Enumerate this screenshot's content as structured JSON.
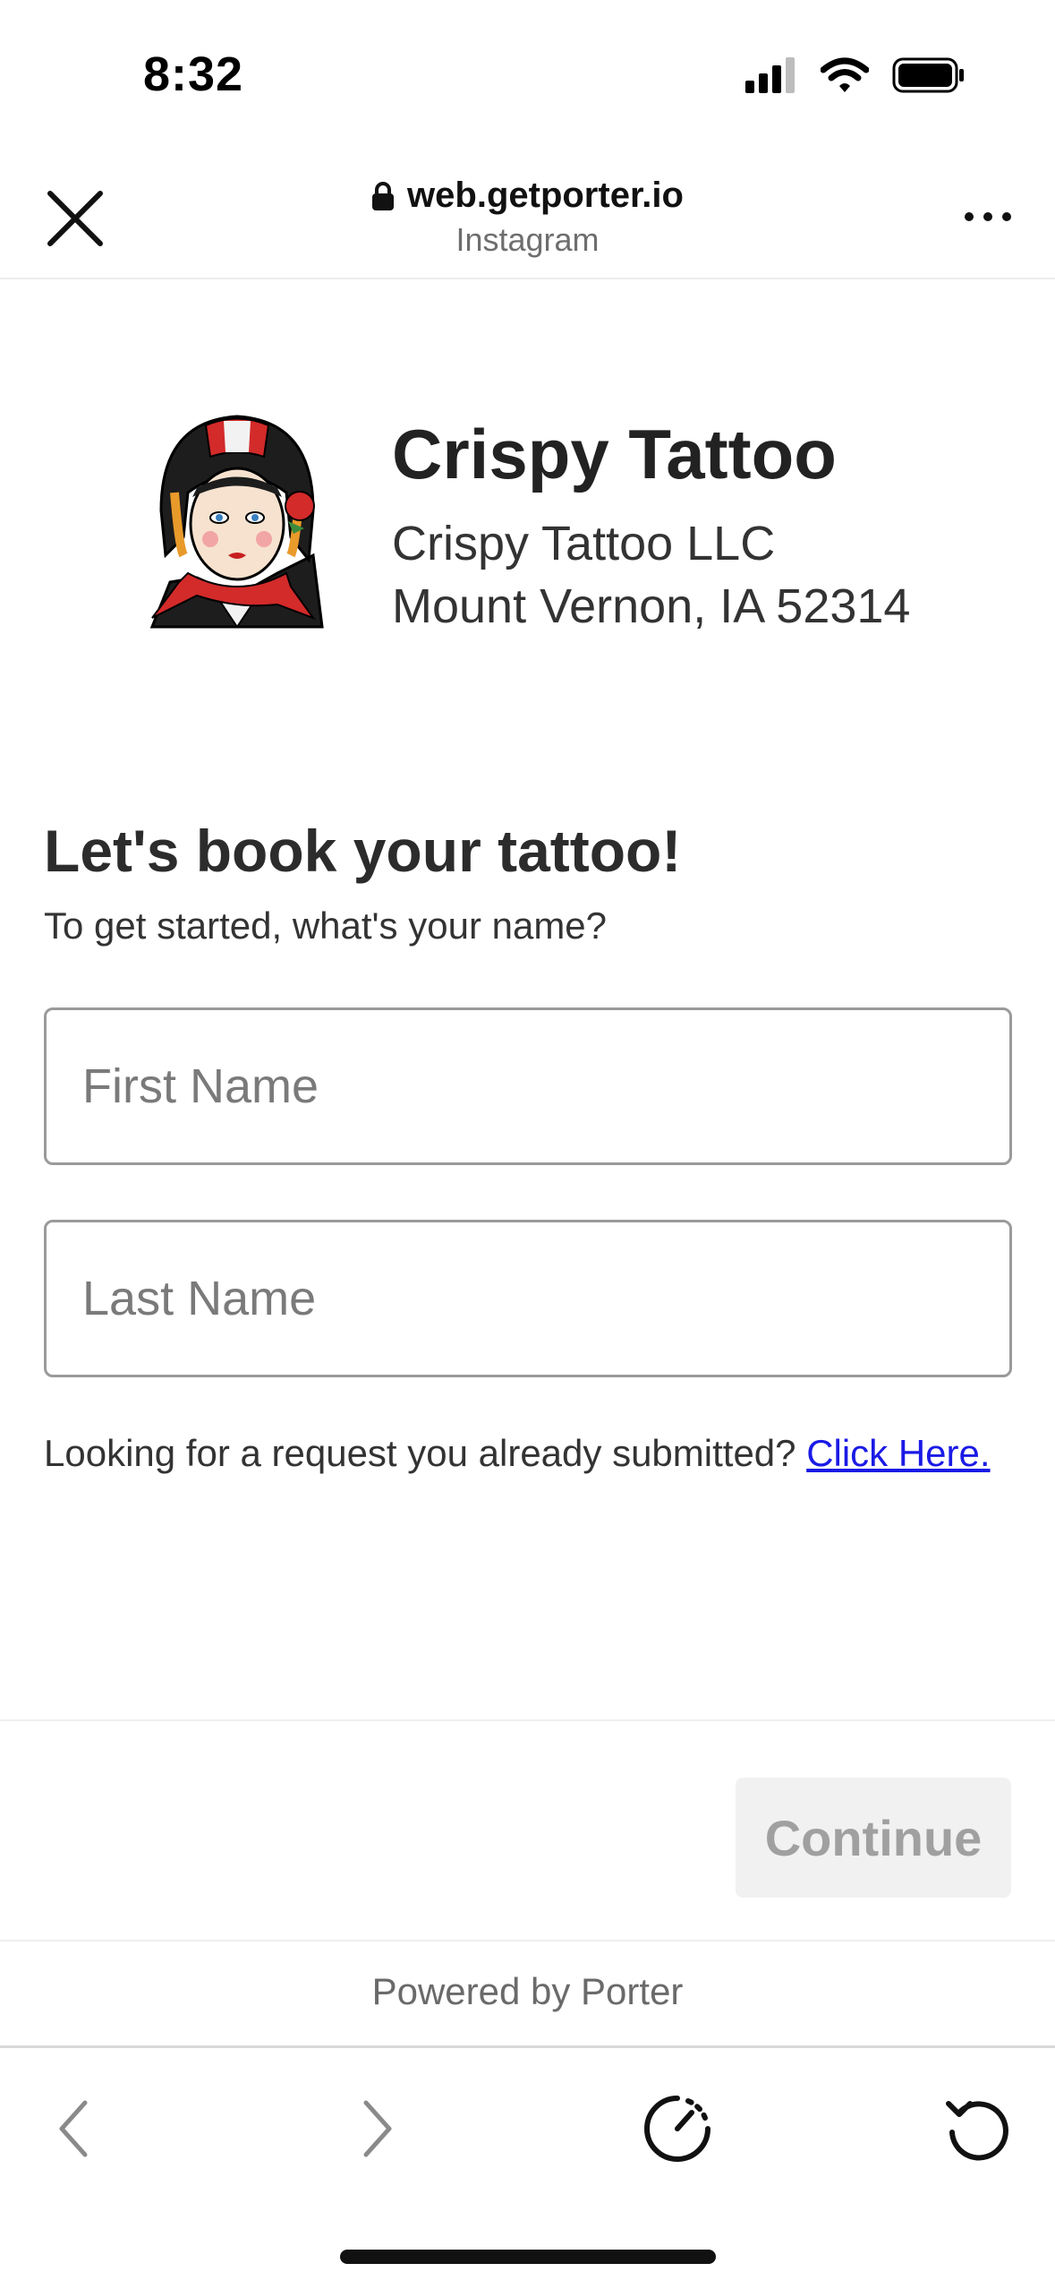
{
  "status_bar": {
    "time": "8:32",
    "icons": [
      "cellular-signal-icon",
      "wifi-icon",
      "battery-icon"
    ]
  },
  "browser": {
    "url": "web.getporter.io",
    "source": "Instagram",
    "icons": [
      "close-icon",
      "lock-icon",
      "more-icon"
    ]
  },
  "business": {
    "name": "Crispy Tattoo",
    "legal_name": "Crispy Tattoo LLC",
    "location": "Mount Vernon, IA 52314"
  },
  "form": {
    "heading": "Let's book your tattoo!",
    "subheading": "To get started, what's your name?",
    "first_name_placeholder": "First Name",
    "first_name_value": "",
    "last_name_placeholder": "Last Name",
    "last_name_value": "",
    "lookup_text": "Looking for a request you already submitted? ",
    "lookup_link": "Click Here."
  },
  "actions": {
    "continue_label": "Continue"
  },
  "footer": {
    "powered_by": "Powered by Porter"
  },
  "toolbar": {
    "icons": [
      "back-icon",
      "forward-icon",
      "speed-icon",
      "reload-icon"
    ]
  },
  "colors": {
    "link": "#1a1ae6",
    "disabled_button_bg": "#f1f1f1",
    "disabled_button_text": "#a0a0a0",
    "field_border": "#9a9a9a"
  }
}
